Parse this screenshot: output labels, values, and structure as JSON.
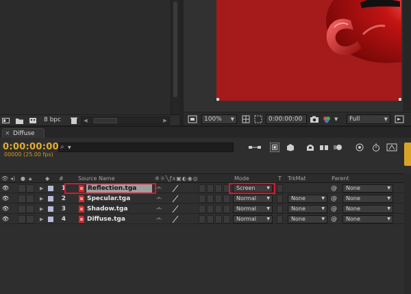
{
  "project": {
    "bit_depth": "8 bpc",
    "icons": [
      "interpret-footage-icon",
      "new-folder-icon",
      "new-comp-icon",
      "trash-icon"
    ]
  },
  "viewer": {
    "zoom": "100%",
    "timecode": "0:00:00:00",
    "resolution": "Full",
    "canvas_color": "#a51a1a"
  },
  "timeline": {
    "tab_label": "Diffuse",
    "current_time": "0:00:00:00",
    "fps_info": "00000 (25.00 fps)",
    "search_placeholder": "",
    "columns": {
      "number": "#",
      "source_name": "Source Name",
      "mode": "Mode",
      "t": "T",
      "trkmat": "TrkMat",
      "parent": "Parent"
    },
    "layers": [
      {
        "num": "1",
        "name": "Reflection.tga",
        "mode": "Screen",
        "trkmat": "",
        "parent": "None",
        "selected": true
      },
      {
        "num": "2",
        "name": "Specular.tga",
        "mode": "Normal",
        "trkmat": "None",
        "parent": "None",
        "selected": false
      },
      {
        "num": "3",
        "name": "Shadow.tga",
        "mode": "Normal",
        "trkmat": "None",
        "parent": "None",
        "selected": false
      },
      {
        "num": "4",
        "name": "Diffuse.tga",
        "mode": "Normal",
        "trkmat": "None",
        "parent": "None",
        "selected": false
      }
    ]
  },
  "colors": {
    "timecode": "#e5ad2a",
    "highlight": "#e3122d",
    "label": "#b8bad8"
  }
}
